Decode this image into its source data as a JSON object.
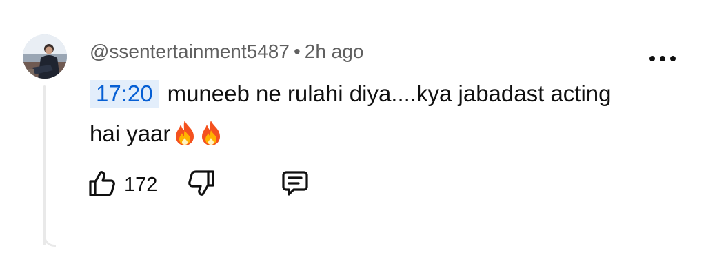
{
  "comment": {
    "author": "@ssentertainment5487",
    "separator": "•",
    "time_ago": "2h ago",
    "timestamp_link": "17:20",
    "text_line": "muneeb ne rulahi diya....kya jabadast acting hai yaar",
    "emojis": [
      "fire-emoji",
      "fire-emoji"
    ],
    "like_count": "172"
  },
  "icons": {
    "like": "thumbs-up-icon",
    "dislike": "thumbs-down-icon",
    "reply": "comment-icon",
    "more": "more-vertical-icon"
  },
  "colors": {
    "timestamp_bg": "#e3eefb",
    "timestamp_text": "#065fd4",
    "meta_text": "#606060",
    "body_text": "#0f0f0f"
  }
}
